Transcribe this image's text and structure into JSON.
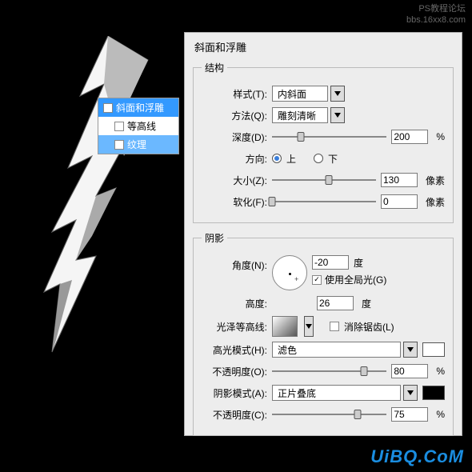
{
  "watermark": {
    "line1": "PS教程论坛",
    "line2": "bbs.16xx8.com",
    "bottom": "UiBQ.CoM"
  },
  "stylelist": {
    "item1": "斜面和浮雕",
    "item2": "等高线",
    "item3": "纹理"
  },
  "panel": {
    "title": "斜面和浮雕",
    "group1": "结构",
    "style_lbl": "样式(T):",
    "style_val": "内斜面",
    "method_lbl": "方法(Q):",
    "method_val": "雕刻清晰",
    "depth_lbl": "深度(D):",
    "depth_val": "200",
    "pct": "%",
    "dir_lbl": "方向:",
    "dir_up": "上",
    "dir_down": "下",
    "size_lbl": "大小(Z):",
    "size_val": "130",
    "px": "像素",
    "soft_lbl": "软化(F):",
    "soft_val": "0",
    "group2": "阴影",
    "angle_lbl": "角度(N):",
    "angle_val": "-20",
    "deg": "度",
    "global_lbl": "使用全局光(G)",
    "alt_lbl": "高度:",
    "alt_val": "26",
    "gloss_lbl": "光泽等高线:",
    "aa_lbl": "消除锯齿(L)",
    "hl_lbl": "高光模式(H):",
    "hl_val": "滤色",
    "hl_op_lbl": "不透明度(O):",
    "hl_op_val": "80",
    "sh_lbl": "阴影模式(A):",
    "sh_val": "正片叠底",
    "sh_op_lbl": "不透明度(C):",
    "sh_op_val": "75"
  }
}
